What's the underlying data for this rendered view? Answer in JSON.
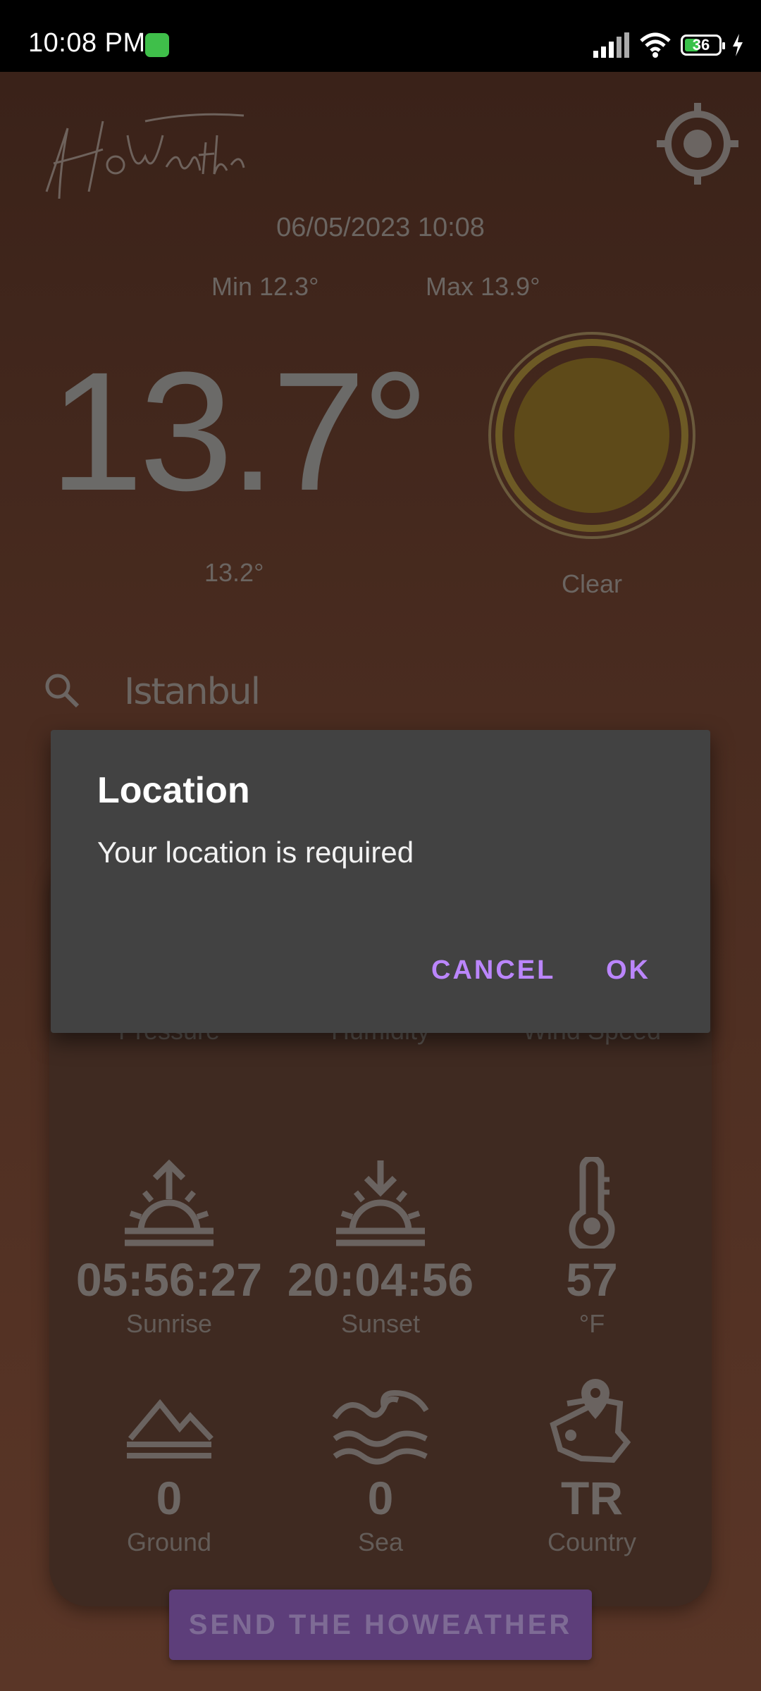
{
  "status_bar": {
    "time": "10:08 PM",
    "battery": "36"
  },
  "header": {
    "logo_alt": "HoWeather"
  },
  "weather": {
    "datetime": "06/05/2023 10:08",
    "min": "Min 12.3°",
    "max": "Max 13.9°",
    "temperature": "13.7°",
    "feels_like": "13.2°",
    "condition": "Clear"
  },
  "search": {
    "value": "Istanbul"
  },
  "details": {
    "top_labels": [
      "Pressure",
      "Humidity",
      "Wind Speed"
    ],
    "sunrise": {
      "value": "05:56:27",
      "label": "Sunrise"
    },
    "sunset": {
      "value": "20:04:56",
      "label": "Sunset"
    },
    "fahrenheit": {
      "value": "57",
      "label": "°F"
    },
    "ground": {
      "value": "0",
      "label": "Ground"
    },
    "sea": {
      "value": "0",
      "label": "Sea"
    },
    "country": {
      "value": "TR",
      "label": "Country"
    }
  },
  "send_button": "SEND THE HOWEATHER",
  "dialog": {
    "title": "Location",
    "message": "Your location is required",
    "cancel": "CANCEL",
    "ok": "OK"
  },
  "colors": {
    "accent": "#bb86fc",
    "dialog_bg": "#424242",
    "sun": "#5e4a19"
  }
}
